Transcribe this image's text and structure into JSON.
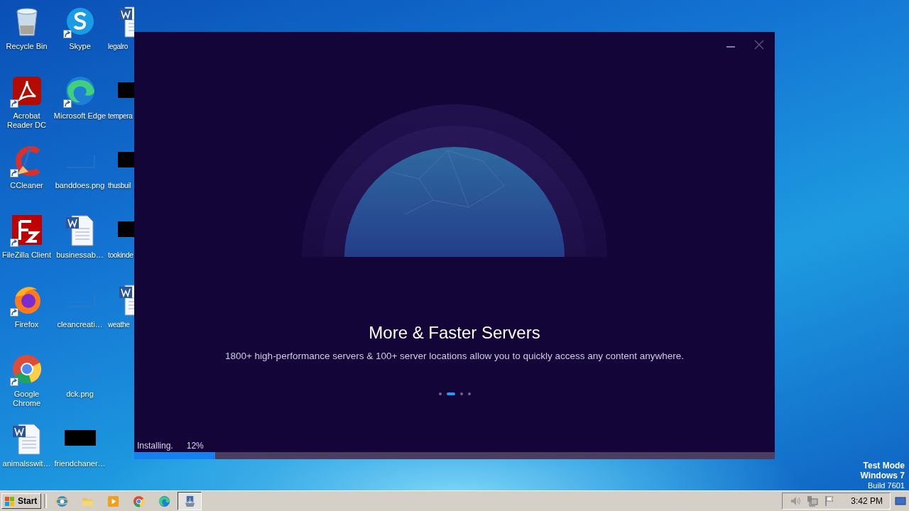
{
  "desktop": {
    "icons": [
      {
        "label": "Recycle Bin",
        "kind": "recycle",
        "shortcut": false
      },
      {
        "label": "Acrobat Reader DC",
        "kind": "acrobat",
        "shortcut": true
      },
      {
        "label": "CCleaner",
        "kind": "ccleaner",
        "shortcut": true
      },
      {
        "label": "FileZilla Client",
        "kind": "filezilla",
        "shortcut": true
      },
      {
        "label": "Firefox",
        "kind": "firefox",
        "shortcut": true
      },
      {
        "label": "Google Chrome",
        "kind": "chrome",
        "shortcut": true
      },
      {
        "label": "animalsswit…",
        "kind": "word",
        "shortcut": false
      },
      {
        "label": "Skype",
        "kind": "skype",
        "shortcut": true
      },
      {
        "label": "Microsoft Edge",
        "kind": "edge",
        "shortcut": true
      },
      {
        "label": "banddoes.png",
        "kind": "blank",
        "shortcut": false
      },
      {
        "label": "businessab…",
        "kind": "word",
        "shortcut": false
      },
      {
        "label": "cleancreati…",
        "kind": "blank",
        "shortcut": false
      },
      {
        "label": "dck.png",
        "kind": "blank",
        "shortcut": false
      },
      {
        "label": "friendchaner…",
        "kind": "redacted",
        "shortcut": false
      },
      {
        "label": "legalro",
        "kind": "word",
        "shortcut": false
      },
      {
        "label": "tempera",
        "kind": "redacted",
        "shortcut": false
      },
      {
        "label": "thusbuil",
        "kind": "redacted",
        "shortcut": false
      },
      {
        "label": "tookinde",
        "kind": "redacted",
        "shortcut": false
      },
      {
        "label": "weathe",
        "kind": "word",
        "shortcut": false
      }
    ],
    "os_notice": {
      "mode": "Test Mode",
      "edition": "Windows 7",
      "build": "Build 7601"
    }
  },
  "installer": {
    "title": "More & Faster Servers",
    "subtitle": "1800+ high-performance servers & 100+ server locations allow you to quickly access any content anywhere.",
    "slides": [
      {
        "selected": false
      },
      {
        "selected": true
      },
      {
        "selected": false
      },
      {
        "selected": false
      }
    ],
    "status": "Installing.",
    "percent": "12%",
    "level": 0.126
  },
  "taskbar": {
    "start": "Start",
    "apps": [
      {
        "kind": "ie",
        "selected": false
      },
      {
        "kind": "folder",
        "selected": false
      },
      {
        "kind": "media",
        "selected": false
      },
      {
        "kind": "chrome",
        "selected": false
      },
      {
        "kind": "edge",
        "selected": false
      },
      {
        "kind": "installer",
        "selected": true
      }
    ],
    "clock": "3:42 PM"
  }
}
